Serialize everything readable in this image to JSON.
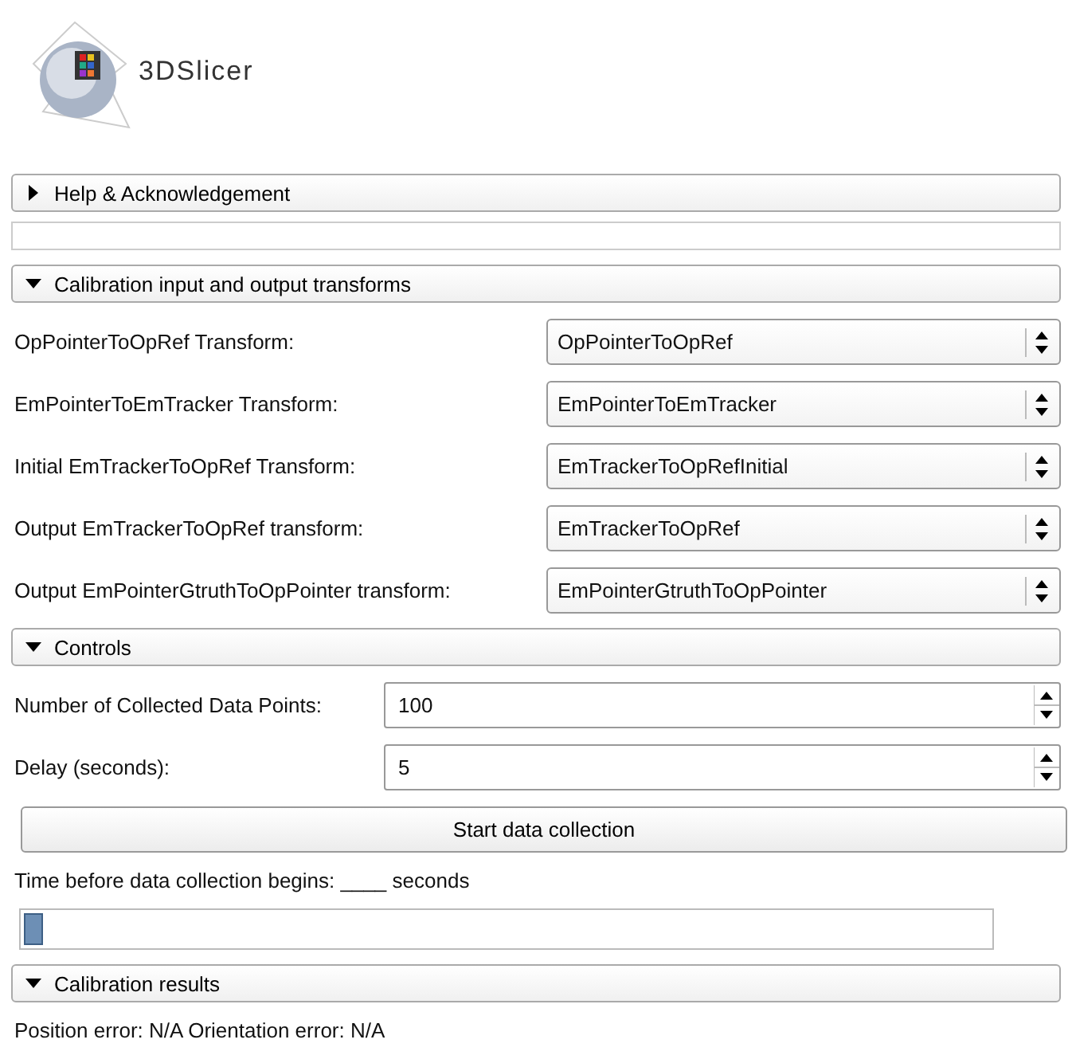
{
  "logo": {
    "text": "3DSlicer"
  },
  "sections": [
    {
      "title": "Help & Acknowledgement",
      "expanded": false
    },
    {
      "title": "Calibration input and output transforms",
      "expanded": true,
      "items": [
        {
          "kind": "combo",
          "label": "OpPointerToOpRef Transform:",
          "value": "OpPointerToOpRef"
        },
        {
          "kind": "combo",
          "label": "EmPointerToEmTracker Transform:",
          "value": "EmPointerToEmTracker"
        },
        {
          "kind": "combo",
          "label": "Initial EmTrackerToOpRef Transform:",
          "value": "EmTrackerToOpRefInitial"
        },
        {
          "kind": "combo",
          "label": "Output EmTrackerToOpRef transform:",
          "value": "EmTrackerToOpRef"
        },
        {
          "kind": "combo",
          "label": "Output EmPointerGtruthToOpPointer transform:",
          "value": "EmPointerGtruthToOpPointer"
        }
      ]
    },
    {
      "title": "Controls",
      "expanded": true,
      "items": [
        {
          "kind": "spin",
          "label": "Number of Collected Data Points:",
          "value": "100"
        },
        {
          "kind": "spin",
          "label": "Delay (seconds):",
          "value": "5"
        },
        {
          "kind": "button",
          "label": "Start data collection"
        },
        {
          "kind": "text",
          "label": "Time before data collection begins:  ____ seconds"
        },
        {
          "kind": "progress",
          "level": 0.02
        }
      ]
    },
    {
      "title": "Calibration results",
      "expanded": true,
      "items": [
        {
          "kind": "text",
          "label": "Position error: N/A Orientation error: N/A"
        }
      ]
    }
  ]
}
